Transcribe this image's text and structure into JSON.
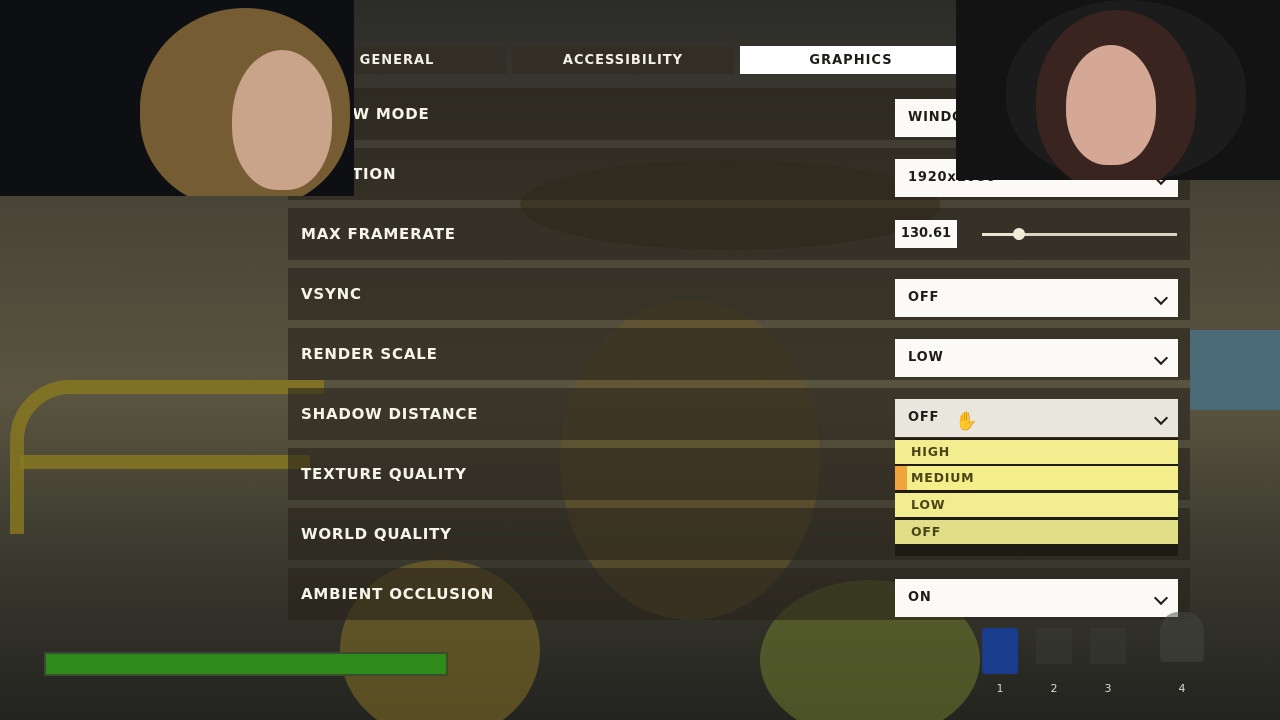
{
  "tabs": {
    "general": "GENERAL",
    "accessibility": "ACCESSIBILITY",
    "graphics": "GRAPHICS"
  },
  "settings": {
    "window_mode": {
      "label": "ow mode",
      "value": "WINDO"
    },
    "resolution": {
      "label": "UTION",
      "value": "1920x1080"
    },
    "max_framerate": {
      "label": "MAX FRAMERATE",
      "value": "130.61",
      "slider_fraction": 0.19
    },
    "vsync": {
      "label": "VSYNC",
      "value": "OFF"
    },
    "render_scale": {
      "label": "RENDER SCALE",
      "value": "LOW"
    },
    "shadow_distance": {
      "label": "SHADOW DISTANCE",
      "value": "OFF"
    },
    "texture_quality": {
      "label": "TEXTURE QUALITY"
    },
    "world_quality": {
      "label": "WORLD QUALITY"
    },
    "ambient_occlusion": {
      "label": "AMBIENT OCCLUSION",
      "value": "ON"
    }
  },
  "dropdown": {
    "options": [
      "HIGH",
      "MEDIUM",
      "LOW",
      "OFF"
    ],
    "highlighted": "MEDIUM",
    "selected": "OFF"
  },
  "hud": {
    "health_fraction": 1.0,
    "hotbar": [
      "1",
      "2",
      "3",
      "4"
    ]
  },
  "icons": {
    "cursor": "hand-cursor-icon",
    "dropdown_arrow": "chevron-down-icon",
    "inventory_item": "passport-icon"
  },
  "colors": {
    "option_bg": "#f2ee90",
    "option_marker": "#f0a53c",
    "health": "#2e8a1a"
  }
}
